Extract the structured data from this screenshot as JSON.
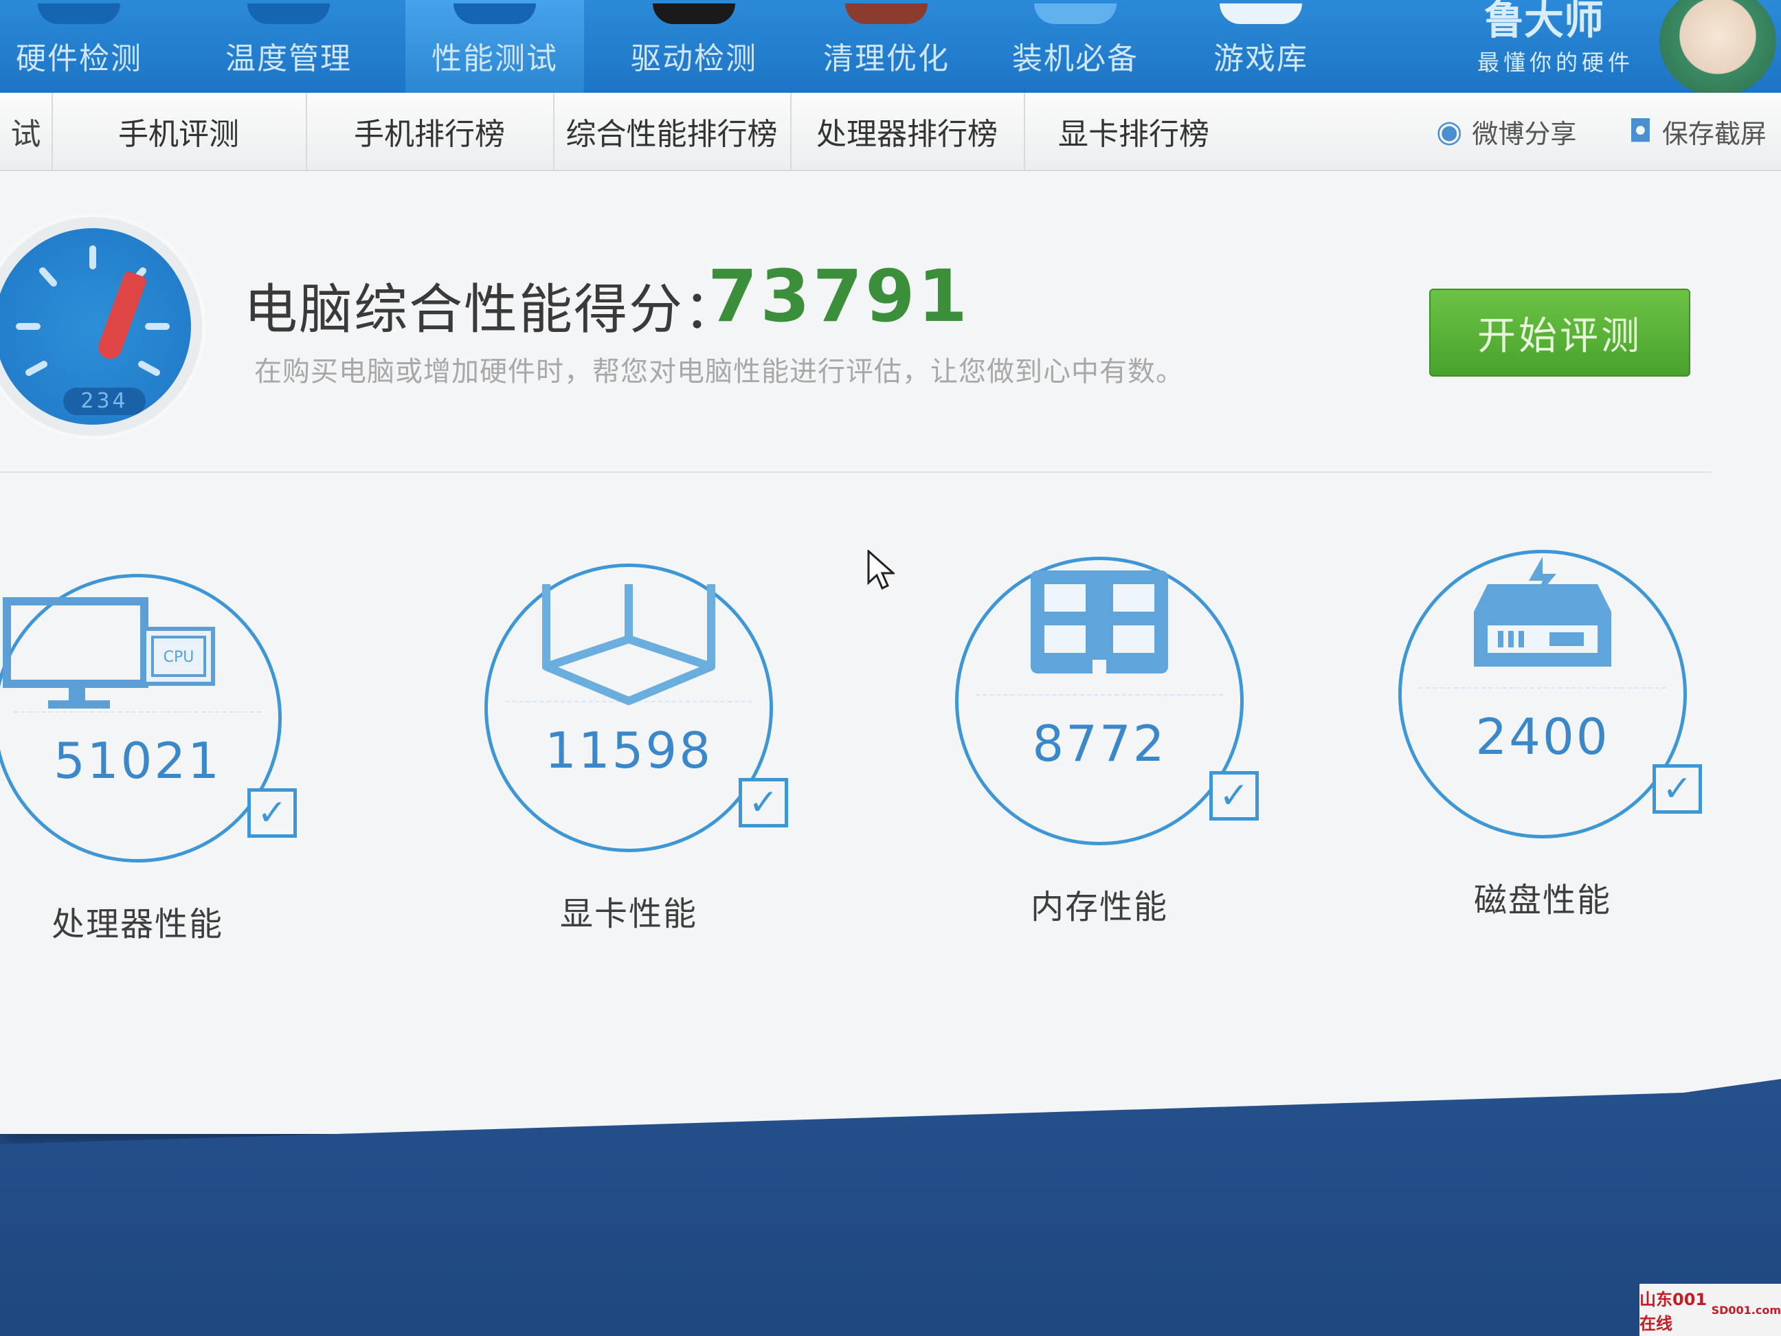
{
  "top_nav": {
    "items": [
      {
        "label": "硬件检测",
        "icon": "hardware-icon"
      },
      {
        "label": "温度管理",
        "icon": "thermometer-icon"
      },
      {
        "label": "性能测试",
        "icon": "speedometer-icon",
        "active": true
      },
      {
        "label": "驱动检测",
        "icon": "driver-icon"
      },
      {
        "label": "清理优化",
        "icon": "broom-icon"
      },
      {
        "label": "装机必备",
        "icon": "box-icon"
      },
      {
        "label": "游戏库",
        "icon": "gamepad-icon"
      }
    ],
    "brand": {
      "title": "鲁大师",
      "slogan": "最懂你的硬件"
    }
  },
  "sub_tabs": {
    "items": [
      "试",
      "手机评测",
      "手机排行榜",
      "综合性能排行榜",
      "处理器排行榜",
      "显卡排行榜"
    ],
    "weibo_share": "微博分享",
    "save_screenshot": "保存截屏"
  },
  "score": {
    "title": "电脑综合性能得分：",
    "value": "73791",
    "description": "在购买电脑或增加硬件时，帮您对电脑性能进行评估，让您做到心中有数。",
    "gauge_readout": "234",
    "start_button": "开始评测"
  },
  "metrics": [
    {
      "label": "处理器性能",
      "value": "51021",
      "checked": true,
      "icon": "cpu-monitor-icon",
      "icon_text": "CPU"
    },
    {
      "label": "显卡性能",
      "value": "11598",
      "checked": true,
      "icon": "graphics-cube-icon"
    },
    {
      "label": "内存性能",
      "value": "8772",
      "checked": true,
      "icon": "memory-chip-icon"
    },
    {
      "label": "磁盘性能",
      "value": "2400",
      "checked": true,
      "icon": "disk-drive-icon"
    }
  ],
  "watermark": {
    "text": "山东001在线",
    "url_text": "SD001.com"
  },
  "colors": {
    "nav_blue": "#1e74c6",
    "score_green": "#3b8f3b",
    "button_green": "#48a22d",
    "metric_blue": "#3d97d6"
  }
}
